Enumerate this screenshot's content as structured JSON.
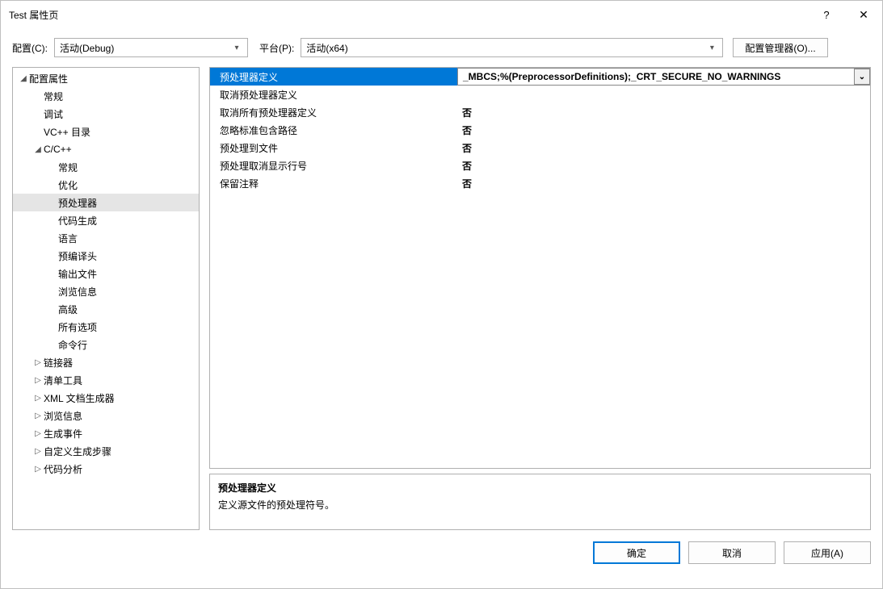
{
  "window": {
    "title": "Test 属性页",
    "help": "?",
    "close": "✕"
  },
  "toolbar": {
    "config_label": "配置(C):",
    "config_value": "活动(Debug)",
    "platform_label": "平台(P):",
    "platform_value": "活动(x64)",
    "manager_button": "配置管理器(O)..."
  },
  "tree": [
    {
      "label": "配置属性",
      "depth": 0,
      "expander": "down"
    },
    {
      "label": "常规",
      "depth": 1,
      "expander": "none"
    },
    {
      "label": "调试",
      "depth": 1,
      "expander": "none"
    },
    {
      "label": "VC++ 目录",
      "depth": 1,
      "expander": "none"
    },
    {
      "label": "C/C++",
      "depth": 1,
      "expander": "down"
    },
    {
      "label": "常规",
      "depth": 2,
      "expander": "none"
    },
    {
      "label": "优化",
      "depth": 2,
      "expander": "none"
    },
    {
      "label": "预处理器",
      "depth": 2,
      "expander": "none",
      "selected": true
    },
    {
      "label": "代码生成",
      "depth": 2,
      "expander": "none"
    },
    {
      "label": "语言",
      "depth": 2,
      "expander": "none"
    },
    {
      "label": "预编译头",
      "depth": 2,
      "expander": "none"
    },
    {
      "label": "输出文件",
      "depth": 2,
      "expander": "none"
    },
    {
      "label": "浏览信息",
      "depth": 2,
      "expander": "none"
    },
    {
      "label": "高级",
      "depth": 2,
      "expander": "none"
    },
    {
      "label": "所有选项",
      "depth": 2,
      "expander": "none"
    },
    {
      "label": "命令行",
      "depth": 2,
      "expander": "none"
    },
    {
      "label": "链接器",
      "depth": 1,
      "expander": "right"
    },
    {
      "label": "清单工具",
      "depth": 1,
      "expander": "right"
    },
    {
      "label": "XML 文档生成器",
      "depth": 1,
      "expander": "right"
    },
    {
      "label": "浏览信息",
      "depth": 1,
      "expander": "right"
    },
    {
      "label": "生成事件",
      "depth": 1,
      "expander": "right"
    },
    {
      "label": "自定义生成步骤",
      "depth": 1,
      "expander": "right"
    },
    {
      "label": "代码分析",
      "depth": 1,
      "expander": "right"
    }
  ],
  "grid": [
    {
      "name": "预处理器定义",
      "value": "_MBCS;%(PreprocessorDefinitions);_CRT_SECURE_NO_WARNINGS",
      "selected": true
    },
    {
      "name": "取消预处理器定义",
      "value": ""
    },
    {
      "name": "取消所有预处理器定义",
      "value": "否"
    },
    {
      "name": "忽略标准包含路径",
      "value": "否"
    },
    {
      "name": "预处理到文件",
      "value": "否"
    },
    {
      "name": "预处理取消显示行号",
      "value": "否"
    },
    {
      "name": "保留注释",
      "value": "否"
    }
  ],
  "description": {
    "title": "预处理器定义",
    "text": "定义源文件的预处理符号。"
  },
  "footer": {
    "ok": "确定",
    "cancel": "取消",
    "apply": "应用(A)"
  }
}
